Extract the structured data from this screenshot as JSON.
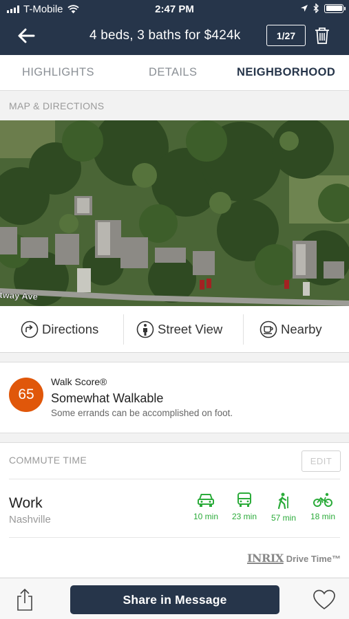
{
  "status_bar": {
    "carrier": "T-Mobile",
    "time": "2:47 PM",
    "icons": [
      "signal-bars",
      "wifi-icon",
      "location-arrow-icon",
      "bluetooth-icon",
      "battery-icon"
    ]
  },
  "nav": {
    "back_icon": "arrow-left-icon",
    "title": "4 beds, 3 baths for $424k",
    "pager": "1/27",
    "trash_icon": "trash-icon"
  },
  "tabs": [
    {
      "label": "HIGHLIGHTS",
      "active": false
    },
    {
      "label": "DETAILS",
      "active": false
    },
    {
      "label": "NEIGHBORHOOD",
      "active": true
    }
  ],
  "map_section": {
    "label": "MAP & DIRECTIONS",
    "street_label": "etway Ave"
  },
  "actions": [
    {
      "label": "Directions",
      "icon": "directions-icon"
    },
    {
      "label": "Street View",
      "icon": "street-view-icon"
    },
    {
      "label": "Nearby",
      "icon": "nearby-coffee-icon"
    }
  ],
  "walk_score": {
    "score": "65",
    "label": "Walk Score®",
    "heading": "Somewhat Walkable",
    "description": "Some errands can be accomplished on foot.",
    "badge_color": "#e0570a"
  },
  "commute": {
    "label": "COMMUTE TIME",
    "edit_label": "EDIT",
    "destination": "Work",
    "city": "Nashville",
    "accent_color": "#2bab3a",
    "modes": [
      {
        "icon": "car-icon",
        "time": "10 min"
      },
      {
        "icon": "bus-icon",
        "time": "23 min"
      },
      {
        "icon": "walking-icon",
        "time": "57 min"
      },
      {
        "icon": "bicycle-icon",
        "time": "18 min"
      }
    ],
    "attribution_brand": "INRIX",
    "attribution_tail": "Drive Time™"
  },
  "bottom_bar": {
    "share_icon": "share-icon",
    "button_label": "Share in Message",
    "favorite_icon": "heart-icon"
  },
  "colors": {
    "navy": "#26354a"
  }
}
